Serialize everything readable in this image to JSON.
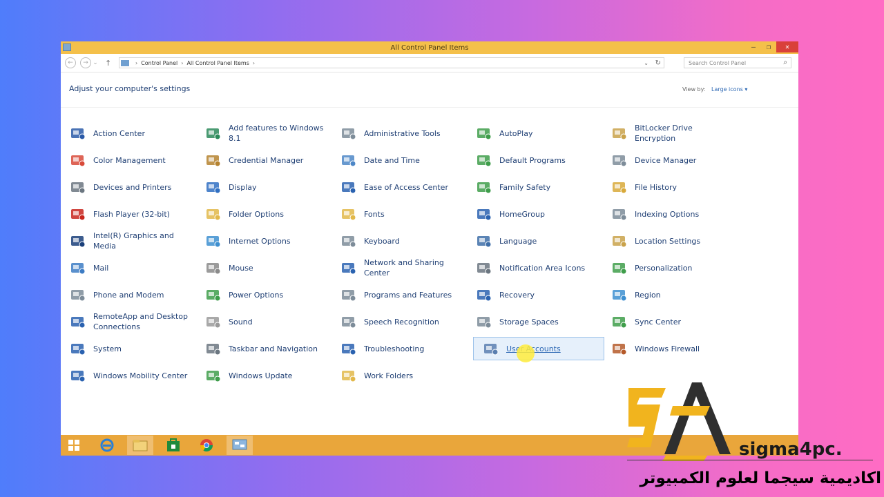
{
  "window": {
    "title": "All Control Panel Items"
  },
  "address": {
    "breadcrumbs": [
      "Control Panel",
      "All Control Panel Items"
    ],
    "search_placeholder": "Search Control Panel"
  },
  "header": {
    "heading": "Adjust your computer's settings",
    "view_by_label": "View by:",
    "view_by_value": "Large icons"
  },
  "items": [
    {
      "label": "Action Center",
      "icon": "flag-icon",
      "color": "#2a5aa8"
    },
    {
      "label": "Add features to Windows 8.1",
      "icon": "add-features-icon",
      "color": "#2b8a5a"
    },
    {
      "label": "Administrative Tools",
      "icon": "admin-tools-icon",
      "color": "#7d8c99"
    },
    {
      "label": "AutoPlay",
      "icon": "autoplay-icon",
      "color": "#3e9d4a"
    },
    {
      "label": "BitLocker Drive Encryption",
      "icon": "key-icon",
      "color": "#c9a24a"
    },
    {
      "label": "Color Management",
      "icon": "color-management-icon",
      "color": "#d84a3a"
    },
    {
      "label": "Credential Manager",
      "icon": "credential-icon",
      "color": "#b5822f"
    },
    {
      "label": "Date and Time",
      "icon": "clock-icon",
      "color": "#4d87c7"
    },
    {
      "label": "Default Programs",
      "icon": "default-programs-icon",
      "color": "#3e9d4a"
    },
    {
      "label": "Device Manager",
      "icon": "device-manager-icon",
      "color": "#7d8c99"
    },
    {
      "label": "Devices and Printers",
      "icon": "printer-icon",
      "color": "#6b7680"
    },
    {
      "label": "Display",
      "icon": "display-icon",
      "color": "#2f6fc2"
    },
    {
      "label": "Ease of Access Center",
      "icon": "ease-access-icon",
      "color": "#2a62b0"
    },
    {
      "label": "Family Safety",
      "icon": "family-icon",
      "color": "#3e9d4a"
    },
    {
      "label": "File History",
      "icon": "file-history-icon",
      "color": "#d8a93a"
    },
    {
      "label": "Flash Player (32-bit)",
      "icon": "flash-icon",
      "color": "#c8261e"
    },
    {
      "label": "Folder Options",
      "icon": "folder-icon",
      "color": "#e2b84a"
    },
    {
      "label": "Fonts",
      "icon": "fonts-icon",
      "color": "#e2b84a"
    },
    {
      "label": "HomeGroup",
      "icon": "homegroup-icon",
      "color": "#2a62b0"
    },
    {
      "label": "Indexing Options",
      "icon": "indexing-icon",
      "color": "#7d8c99"
    },
    {
      "label": "Intel(R) Graphics and Media",
      "icon": "intel-graphics-icon",
      "color": "#1a3f7a"
    },
    {
      "label": "Internet Options",
      "icon": "internet-icon",
      "color": "#3d8fd0"
    },
    {
      "label": "Keyboard",
      "icon": "keyboard-icon",
      "color": "#7d8c99"
    },
    {
      "label": "Language",
      "icon": "language-icon",
      "color": "#3e6ea8"
    },
    {
      "label": "Location Settings",
      "icon": "location-icon",
      "color": "#c9a24a"
    },
    {
      "label": "Mail",
      "icon": "mail-icon",
      "color": "#3d7cc4"
    },
    {
      "label": "Mouse",
      "icon": "mouse-icon",
      "color": "#8a8a8a"
    },
    {
      "label": "Network and Sharing Center",
      "icon": "network-icon",
      "color": "#2a62b0"
    },
    {
      "label": "Notification Area Icons",
      "icon": "notification-icon",
      "color": "#6b7680"
    },
    {
      "label": "Personalization",
      "icon": "personalization-icon",
      "color": "#3e9d4a"
    },
    {
      "label": "Phone and Modem",
      "icon": "phone-icon",
      "color": "#7d8c99"
    },
    {
      "label": "Power Options",
      "icon": "power-icon",
      "color": "#3e9d4a"
    },
    {
      "label": "Programs and Features",
      "icon": "programs-icon",
      "color": "#7d8c99"
    },
    {
      "label": "Recovery",
      "icon": "recovery-icon",
      "color": "#2a62b0"
    },
    {
      "label": "Region",
      "icon": "region-icon",
      "color": "#3d8fd0"
    },
    {
      "label": "RemoteApp and Desktop Connections",
      "icon": "remoteapp-icon",
      "color": "#2a62b0"
    },
    {
      "label": "Sound",
      "icon": "sound-icon",
      "color": "#9a9a9a"
    },
    {
      "label": "Speech Recognition",
      "icon": "microphone-icon",
      "color": "#7d8c99"
    },
    {
      "label": "Storage Spaces",
      "icon": "storage-icon",
      "color": "#7d8c99"
    },
    {
      "label": "Sync Center",
      "icon": "sync-icon",
      "color": "#3e9d4a"
    },
    {
      "label": "System",
      "icon": "system-icon",
      "color": "#2a62b0"
    },
    {
      "label": "Taskbar and Navigation",
      "icon": "taskbar-icon",
      "color": "#6b7680"
    },
    {
      "label": "Troubleshooting",
      "icon": "troubleshooting-icon",
      "color": "#2a62b0"
    },
    {
      "label": "User Accounts",
      "icon": "user-accounts-icon",
      "color": "#5a7fb0",
      "selected": true
    },
    {
      "label": "Windows Firewall",
      "icon": "firewall-icon",
      "color": "#b55a2a"
    },
    {
      "label": "Windows Mobility Center",
      "icon": "mobility-icon",
      "color": "#2a62b0"
    },
    {
      "label": "Windows Update",
      "icon": "windows-update-icon",
      "color": "#3e9d4a"
    },
    {
      "label": "Work Folders",
      "icon": "work-folders-icon",
      "color": "#e2b84a"
    }
  ],
  "taskbar": {
    "apps": [
      "windows-start-icon",
      "internet-explorer-icon",
      "file-explorer-icon",
      "store-icon",
      "chrome-icon",
      "control-panel-icon"
    ]
  },
  "watermark": {
    "brand": "sigma4pc.",
    "arabic": "اكاديمية سيجما لعلوم الكمبيوتر"
  },
  "colors": {
    "titlebar": "#f4c04a",
    "taskbar": "#e9a63b",
    "link": "#1e3e73",
    "selection": "#e6f0fb"
  }
}
